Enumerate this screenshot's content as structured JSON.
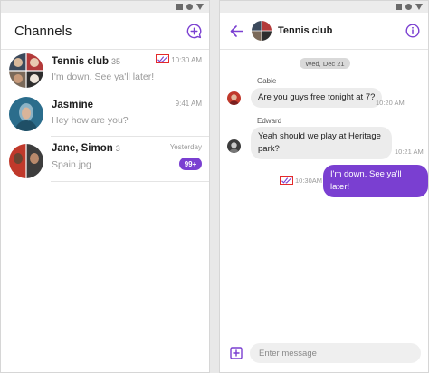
{
  "colors": {
    "accent": "#7a3fd1",
    "highlight_box": "#e52a2a"
  },
  "channels_panel": {
    "title": "Channels",
    "new_chat_icon": "chat-plus-icon",
    "items": [
      {
        "name": "Tennis club",
        "count": "35",
        "last_message": "I'm down. See ya'll later!",
        "time": "10:30 AM",
        "status_icon": "double-check-icon"
      },
      {
        "name": "Jasmine",
        "count": "",
        "last_message": "Hey how are you?",
        "time": "9:41 AM"
      },
      {
        "name": "Jane, Simon",
        "count": "3",
        "last_message": "Spain.jpg",
        "time": "Yesterday",
        "unread": "99+"
      }
    ]
  },
  "chat_panel": {
    "title": "Tennis club",
    "back_icon": "arrow-left-icon",
    "info_icon": "info-icon",
    "date_separator": "Wed, Dec 21",
    "messages": [
      {
        "sender": "Gabie",
        "text": "Are you guys free tonight at 7?",
        "time": "10:20 AM"
      },
      {
        "sender": "Edward",
        "text_line1": "Yeah should we play at Heritage",
        "text_line2": "park?",
        "time": "10:21 AM"
      },
      {
        "sender": "",
        "text": "I'm down. See ya'll later!",
        "time": "10:30AM",
        "status_icon": "double-check-icon"
      }
    ],
    "composer": {
      "attach_icon": "plus-square-icon",
      "placeholder": "Enter message"
    }
  }
}
